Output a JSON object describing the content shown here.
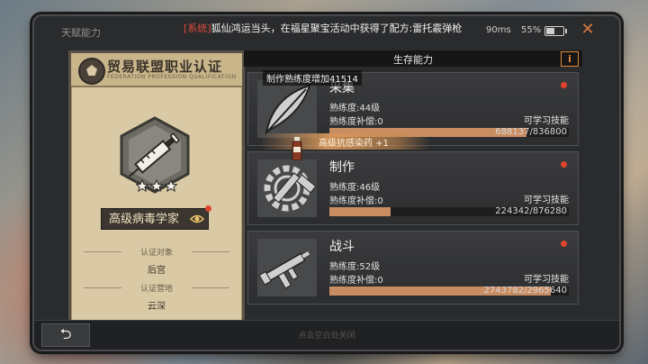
{
  "tab_title": "天赋能力",
  "ticker": {
    "tag": "[系统]",
    "text": "狐仙鸿运当头，在福星聚宝活动中获得了配方:雷托霰弹枪"
  },
  "status": {
    "ping": "90ms",
    "battery": "55%",
    "battery_level": 0.55
  },
  "card": {
    "title": "贸易联盟职业认证",
    "subtitle": "FEDERATION PROFESSION QUALIFICATION",
    "job": "高级病毒学家",
    "target_label": "认证对象",
    "target_value": "后宫",
    "camp_label": "认证营地",
    "camp_value": "云深"
  },
  "section": {
    "title": "生存能力",
    "info": "i"
  },
  "tooltip": "制作熟练度增加41514",
  "gain": "高级抗感染药 +1",
  "skills": [
    {
      "name": "采集",
      "level": "熟练度:44级",
      "comp": "熟练度补偿:0",
      "learn": "可学习技能",
      "progress_text": "688137/836800",
      "progress": 0.822
    },
    {
      "name": "制作",
      "level": "熟练度:46级",
      "comp": "熟练度补偿:0",
      "learn": "可学习技能",
      "progress_text": "224342/876280",
      "progress": 0.256
    },
    {
      "name": "战斗",
      "level": "熟练度:52级",
      "comp": "熟练度补偿:0",
      "learn": "可学习技能",
      "progress_text": "2743782/2965640",
      "progress": 0.925
    }
  ],
  "footer": {
    "back": "⮌",
    "hint": "点击空白处关闭"
  },
  "colors": {
    "accent": "#e0893c",
    "progress": "#c98d62",
    "alert": "#e0432c"
  }
}
